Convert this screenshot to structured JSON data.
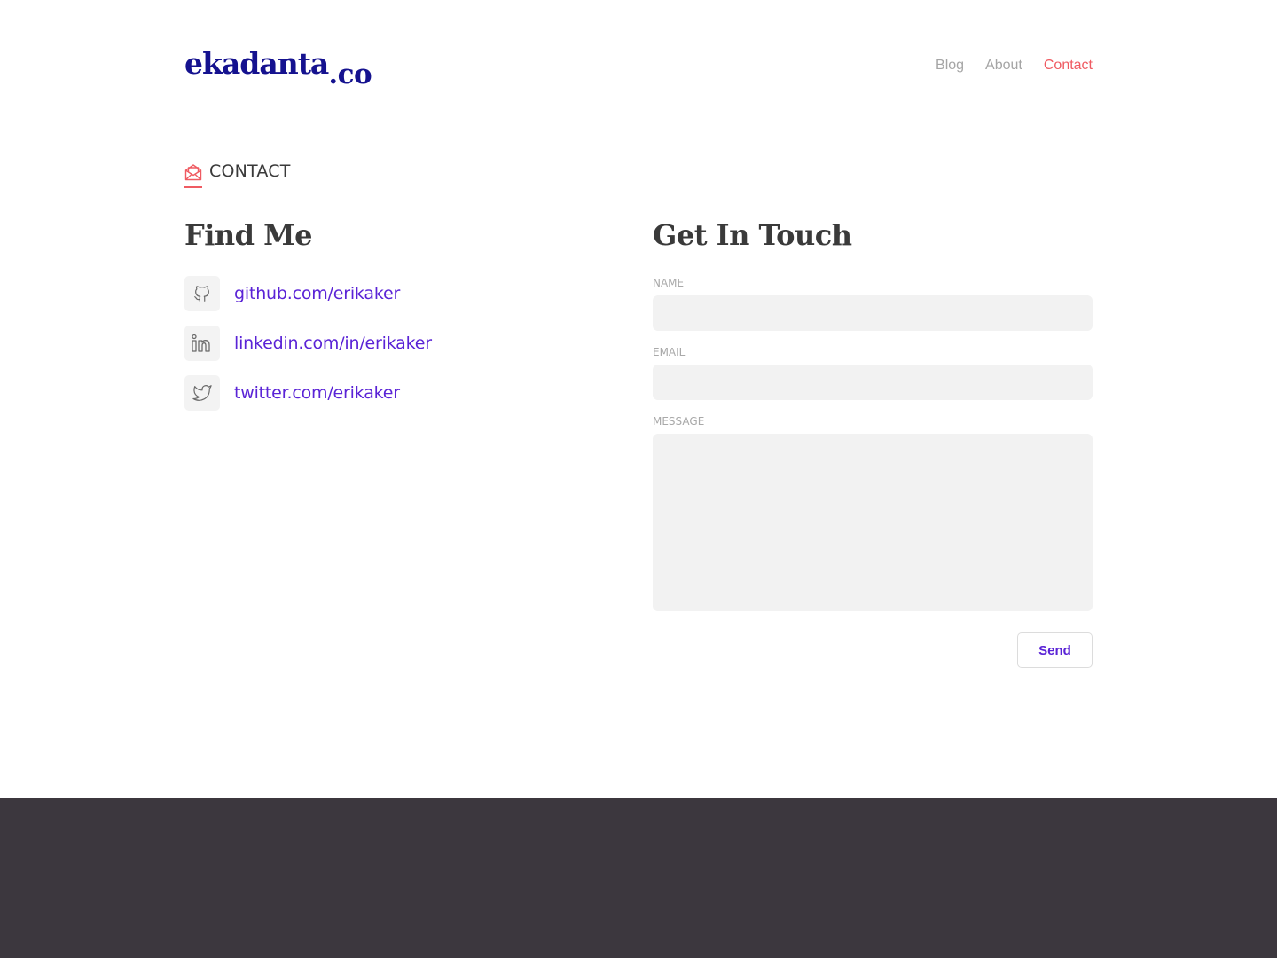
{
  "header": {
    "logo_main": "ekadanta",
    "logo_tld": ".co",
    "nav": [
      {
        "label": "Blog",
        "active": false
      },
      {
        "label": "About",
        "active": false
      },
      {
        "label": "Contact",
        "active": true
      }
    ]
  },
  "section": {
    "label": "CONTACT",
    "icon": "envelope-open-icon"
  },
  "find_me": {
    "title": "Find Me",
    "links": [
      {
        "icon": "github-icon",
        "text": "github.com/erikaker"
      },
      {
        "icon": "linkedin-icon",
        "text": "linkedin.com/in/erikaker"
      },
      {
        "icon": "twitter-icon",
        "text": "twitter.com/erikaker"
      }
    ]
  },
  "get_in_touch": {
    "title": "Get In Touch",
    "fields": {
      "name_label": "NAME",
      "name_value": "",
      "email_label": "EMAIL",
      "email_value": "",
      "message_label": "MESSAGE",
      "message_value": ""
    },
    "send_label": "Send"
  },
  "colors": {
    "brand": "#15128f",
    "accent": "#ef5b62",
    "link": "#5a23d6",
    "footer": "#3c373e"
  }
}
